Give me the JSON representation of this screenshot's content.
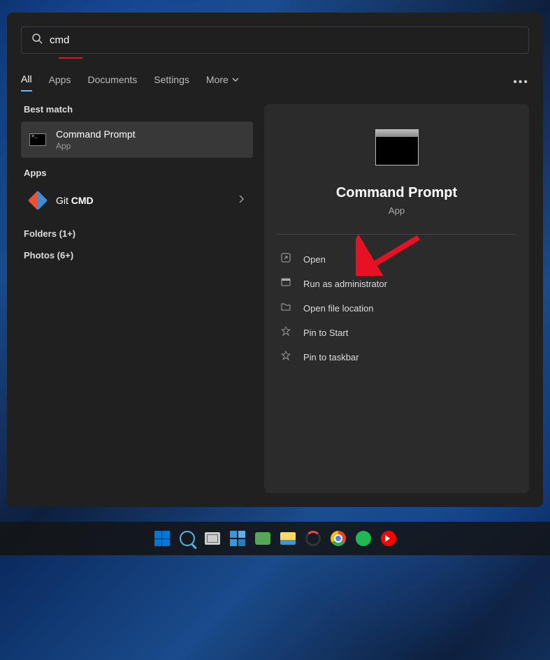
{
  "search": {
    "value": "cmd"
  },
  "tabs": {
    "all": "All",
    "apps": "Apps",
    "documents": "Documents",
    "settings": "Settings",
    "more": "More"
  },
  "sections": {
    "best_match": "Best match",
    "apps": "Apps"
  },
  "results": {
    "best": {
      "title": "Command Prompt",
      "subtitle": "App"
    },
    "app1": {
      "title_prefix": "Git ",
      "title_bold": "CMD"
    }
  },
  "links": {
    "folders": "Folders (1+)",
    "photos": "Photos (6+)"
  },
  "preview": {
    "title": "Command Prompt",
    "subtitle": "App"
  },
  "actions": {
    "open": "Open",
    "admin": "Run as administrator",
    "location": "Open file location",
    "pin_start": "Pin to Start",
    "pin_taskbar": "Pin to taskbar"
  }
}
